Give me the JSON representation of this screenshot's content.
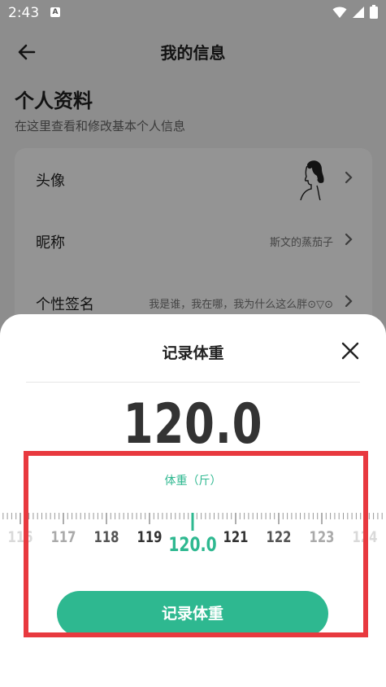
{
  "status_bar": {
    "time": "2:43",
    "notification_icon": "A"
  },
  "header": {
    "title": "我的信息"
  },
  "profile": {
    "section_title": "个人资料",
    "section_subtitle": "在这里查看和修改基本个人信息",
    "rows": [
      {
        "label": "头像",
        "value": ""
      },
      {
        "label": "昵称",
        "value": "斯文的蒸茄子"
      },
      {
        "label": "个性签名",
        "value": "我是谁，我在哪，我为什么这么胖⊙▽⊙"
      }
    ]
  },
  "sheet": {
    "title": "记录体重",
    "current_weight": "120.0",
    "unit_label": "体重（斤）",
    "ruler": {
      "labels": [
        "116",
        "117",
        "118",
        "119",
        "120.0",
        "121",
        "122",
        "123",
        "124"
      ],
      "selected_label": "120.0"
    },
    "record_button": "记录体重"
  },
  "colors": {
    "accent": "#2eb890",
    "highlight": "#e8393f",
    "overlay": "rgba(0,0,0,0.42)"
  }
}
